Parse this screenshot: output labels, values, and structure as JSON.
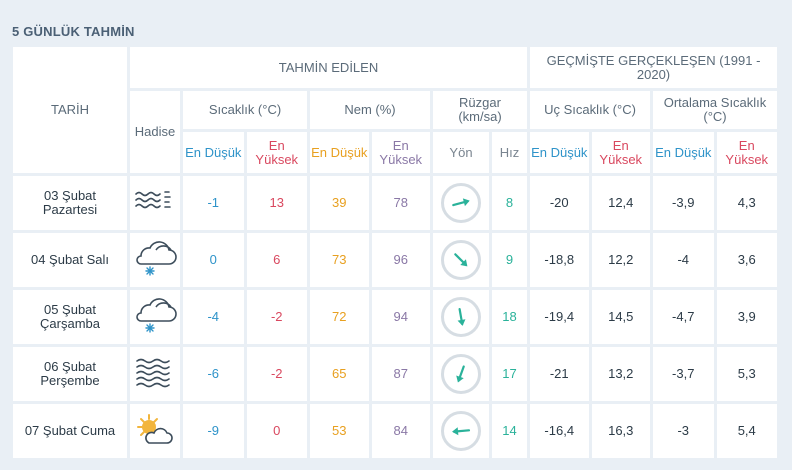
{
  "title": "5 GÜNLÜK TAHMİN",
  "header": {
    "tarih": "TARİH",
    "tahmin_edilen": "TAHMİN EDİLEN",
    "gecmiste": "GEÇMİŞTE GERÇEKLEŞEN (1991 - 2020)",
    "hadise": "Hadise",
    "sicaklik": "Sıcaklık (°C)",
    "nem": "Nem (%)",
    "ruzgar": "Rüzgar (km/sa)",
    "uc_sicaklik": "Uç Sıcaklık (°C)",
    "ortalama_sicaklik": "Ortalama Sıcaklık (°C)",
    "en_dusuk": "En Düşük",
    "en_yuksek": "En Yüksek",
    "yon": "Yön",
    "hiz": "Hız"
  },
  "rows": [
    {
      "date": "03 Şubat Pazartesi",
      "icon": "fog-icon",
      "t_min": "-1",
      "t_max": "13",
      "h_min": "39",
      "h_max": "78",
      "wind_dir_deg": 75,
      "wind_speed": "8",
      "x_min": "-20",
      "x_max": "12,4",
      "a_min": "-3,9",
      "a_max": "4,3"
    },
    {
      "date": "04 Şubat Salı",
      "icon": "snow-cloud-icon",
      "t_min": "0",
      "t_max": "6",
      "h_min": "73",
      "h_max": "96",
      "wind_dir_deg": 135,
      "wind_speed": "9",
      "x_min": "-18,8",
      "x_max": "12,2",
      "a_min": "-4",
      "a_max": "3,6"
    },
    {
      "date": "05 Şubat Çarşamba",
      "icon": "snow-cloud-icon",
      "t_min": "-4",
      "t_max": "-2",
      "h_min": "72",
      "h_max": "94",
      "wind_dir_deg": 170,
      "wind_speed": "18",
      "x_min": "-19,4",
      "x_max": "14,5",
      "a_min": "-4,7",
      "a_max": "3,9"
    },
    {
      "date": "06 Şubat Perşembe",
      "icon": "haze-icon",
      "t_min": "-6",
      "t_max": "-2",
      "h_min": "65",
      "h_max": "87",
      "wind_dir_deg": 200,
      "wind_speed": "17",
      "x_min": "-21",
      "x_max": "13,2",
      "a_min": "-3,7",
      "a_max": "5,3"
    },
    {
      "date": "07 Şubat Cuma",
      "icon": "partly-sunny-icon",
      "t_min": "-9",
      "t_max": "0",
      "h_min": "53",
      "h_max": "84",
      "wind_dir_deg": 265,
      "wind_speed": "14",
      "x_min": "-16,4",
      "x_max": "16,3",
      "a_min": "-3",
      "a_max": "5,4"
    }
  ],
  "colors": {
    "accent_blue": "#2e93c9",
    "accent_red": "#d9485f",
    "humidity_low": "#e8a020",
    "humidity_high": "#8a78a6",
    "wind": "#2ab29a"
  }
}
